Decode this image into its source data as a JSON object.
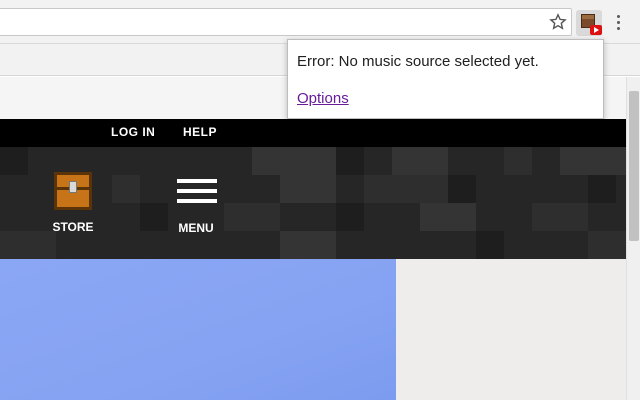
{
  "browser": {
    "toolbar_icons": [
      "star-icon",
      "extension-icon",
      "more-vert-icon"
    ]
  },
  "popup": {
    "message": "Error: No music source selected yet.",
    "options_link": "Options"
  },
  "site": {
    "top_links": [
      "LOG IN",
      "HELP"
    ],
    "nav": {
      "store_label": "STORE",
      "menu_label": "MENU"
    }
  },
  "colors": {
    "topbar": "#000000",
    "navband": "#262626",
    "hero": "#8aa7f5",
    "link_visited": "#6a1b9a"
  }
}
